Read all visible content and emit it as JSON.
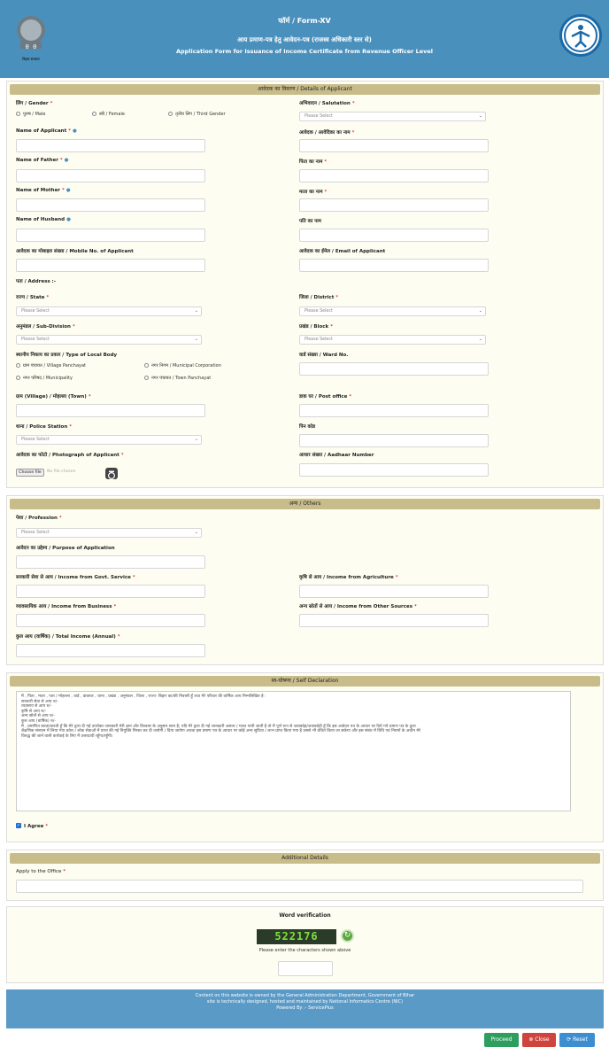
{
  "header": {
    "form_label": "फॉर्म / Form-XV",
    "title_hi": "आय प्रमाण-पत्र हेतु आवेदन-पत्र (राजस्व अधिकारी स्तर से)",
    "title_en": "Application Form for Issuance of Income Certificate from Revenue Officer Level",
    "left_logo_caption": "बिहार सरकार"
  },
  "applicant": {
    "section_title": "आवेदक का विवरण / Details of Applicant",
    "gender_label": "लिंग / Gender",
    "gender_options": [
      "पुरुष / Male",
      "स्त्री / Female",
      "तृतीय लिंग / Third Gender"
    ],
    "salutation_label": "अभिवादन / Salutation",
    "select_placeholder": "Please Select",
    "name_label": "Name of Applicant",
    "name_hi_label": "आवेदक / आवेदिका का नाम",
    "father_label": "Name of Father",
    "father_hi_label": "पिता का नाम",
    "mother_label": "Name of Mother",
    "mother_hi_label": "माता का नाम",
    "husband_label": "Name of Husband",
    "husband_hi_label": "पति का नाम",
    "mobile_label": "आवेदक का मोबाइल संख्या / Mobile No. of Applicant",
    "email_label": "आवेदक का ईमेल / Email of Applicant",
    "address_label": "पता / Address :-",
    "state_label": "राज्य / State",
    "district_label": "जिला / District",
    "subdivision_label": "अनुमंडल / Sub-Division",
    "block_label": "प्रखंड / Block",
    "localbody_label": "स्थानीय निकाय का प्रकार / Type of Local Body",
    "localbody_options": [
      "ग्राम पंचायत / Village Panchayat",
      "नगर निगम / Municipal Corporation",
      "नगर परिषद / Municipality",
      "नगर पंचायत / Town Panchayat"
    ],
    "ward_label": "वार्ड संख्या / Ward No.",
    "village_label": "ग्राम (Village) / मोहल्ला (Town)",
    "postoffice_label": "डाक घर / Post office",
    "police_label": "थाना / Police Station",
    "pincode_label": "पिन कोड",
    "photo_label": "आवेदक का फोटो / Photograph of Applicant",
    "choose_file": "Choose file",
    "no_file": "No file chosen",
    "aadhaar_label": "आधार संख्या / Aadhaar Number"
  },
  "others": {
    "section_title": "अन्य / Others",
    "profession_label": "पेशा / Profession",
    "purpose_label": "आवेदन का उद्देश्य / Purpose of Application",
    "govt_income_label": "सरकारी सेवा से आय / Income from Govt. Service",
    "agri_income_label": "कृषि से आय / Income from Agriculture",
    "business_income_label": "व्यावसायिक आय / Income from Business",
    "other_income_label": "अन्य स्रोतों से आय / Income from Other Sources",
    "total_income_label": "कुल आय (वार्षिक) / Total Income (Annual)"
  },
  "declaration": {
    "section_title": "स्व-घोषणा / Self Declaration",
    "lines": [
      "मैं , पिता , माता , पता / मोहल्ला , वार्ड , डाकघर , थाना , प्रखंड , अनुमंडल , जिला , राज्य- बिहार का/की निवासी हूँ तथा मेरे परिवार की वार्षिक आय निम्नलिखित है :",
      "सरकारी सेवा से आय रु/-",
      "व्यवसाय से आय रु/-",
      "कृषि से आय रु/-",
      "अन्य स्रोतों से आय रु/-",
      "कुल आय (वार्षिक) रु/-",
      "मैं , प्रमाणित करता/करती हूँ कि मेरे द्वारा दी गई उपरोक्त जानकारी मेरी ज्ञान और विश्वास के अनुसार सत्य है; यदि मेरे द्वारा दी गई जानकारी असत्य / गलत पायी जाती है तो मैं पूर्ण रूप से जवाबदेह/जवाबदेही हूँ कि इस आवेदन पत्र के आधार पर दिये गये प्रमाण पत्र के द्वारा",
      "शैक्षणिक संस्थान में लिया गया प्रवेश / लोक सेवाओं में प्राप्त की गई नियुक्ति निरस्त कर दी जायेगी / दिया जायेगा अथवा इस प्रमाण पत्र के आधार पर कोई अन्य सुविधा / लाभ प्राप्त किया गया है उससे भी वंचित किया जा सकेगा और इस संबंध में विधि एवं नियमों के अधीन मेरे",
      "विरुद्ध की जाने वाली कार्रवाई के लिए मैं उत्तरदायी रहूँगा/रहूँगी।"
    ],
    "agree_label": "I Agree"
  },
  "additional": {
    "section_title": "Additional Details",
    "apply_office_label": "Apply to the Office"
  },
  "verification": {
    "title": "Word verification",
    "captcha_text": "522176",
    "instruction": "Please enter the characters shown above"
  },
  "footer": {
    "line1": "Content on this website is owned by the General Administration Department, Government of Bihar",
    "line2": "site is technically designed, hosted and maintained by National Informatics Centre (NIC)",
    "line3": "Powered By :- ServicePlus"
  },
  "buttons": {
    "proceed": "Proceed",
    "close": "Close",
    "reset": "Reset"
  },
  "colors": {
    "header_bg": "#4a90bd",
    "section_header_bg": "#c8bd8a",
    "proceed": "#2e9e5e",
    "close": "#d0443e",
    "reset": "#3c8ed1"
  }
}
